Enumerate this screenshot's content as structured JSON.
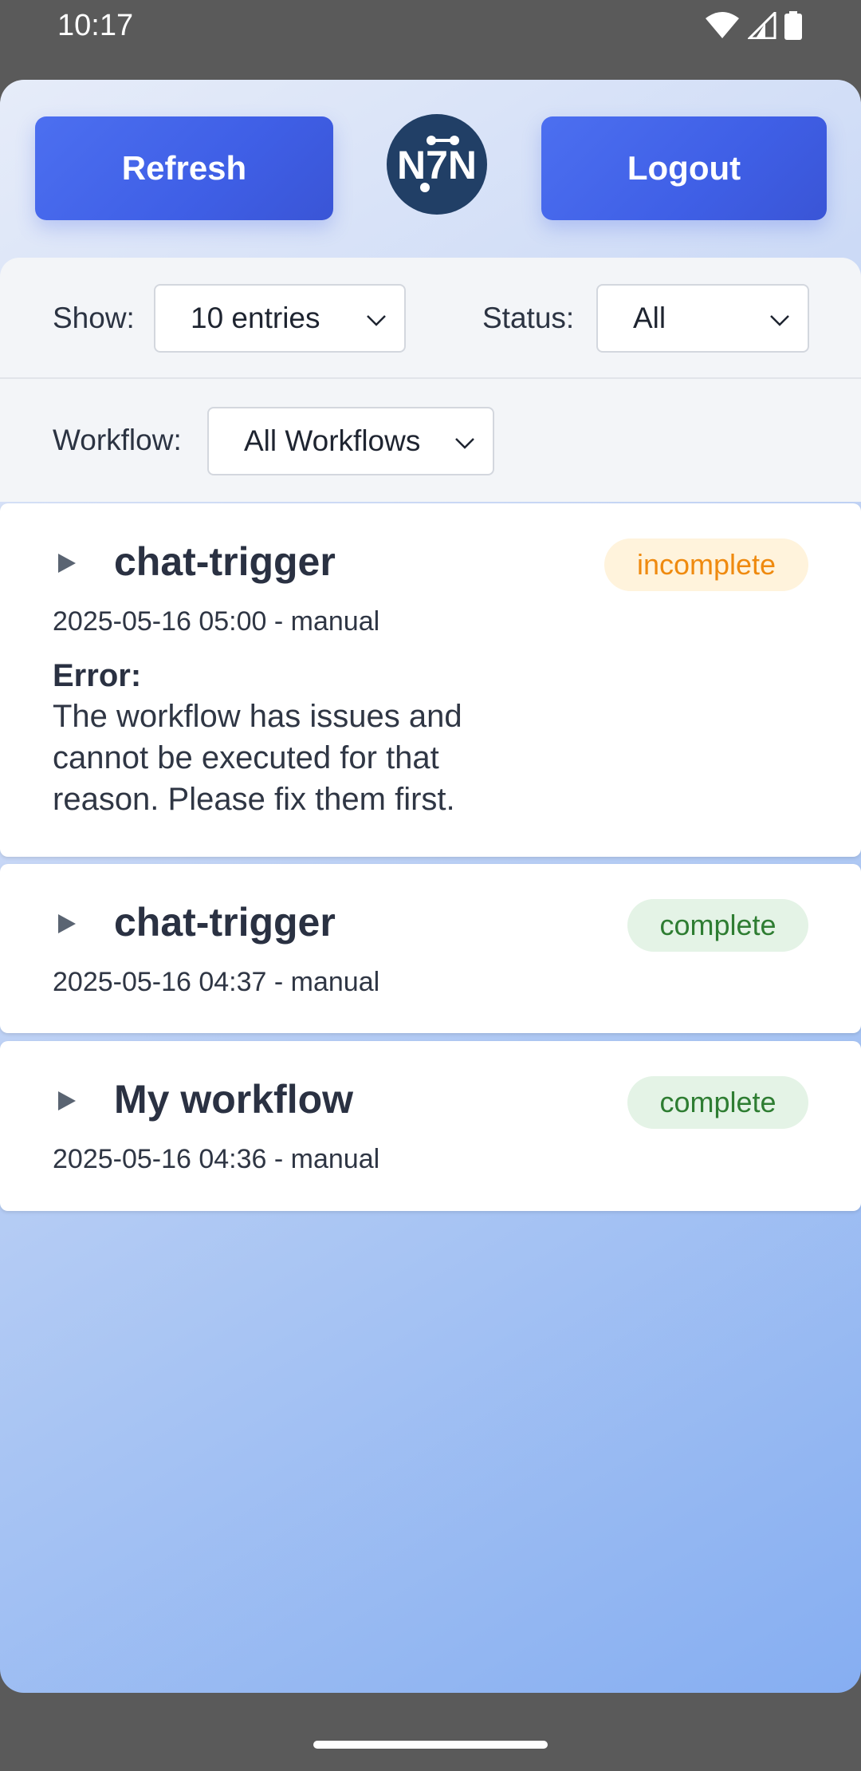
{
  "status_bar": {
    "time": "10:17",
    "icons": [
      "wifi-icon",
      "signal-icon",
      "battery-icon"
    ]
  },
  "header": {
    "refresh_label": "Refresh",
    "logout_label": "Logout",
    "logo_text": "N7N",
    "logo_icon": "n8n-logo"
  },
  "filters": {
    "show_label": "Show:",
    "show_value": "10 entries",
    "status_label": "Status:",
    "status_value": "All",
    "workflow_label": "Workflow:",
    "workflow_value": "All Workflows"
  },
  "executions": [
    {
      "name": "chat-trigger",
      "meta": "2025-05-16 05:00 - manual",
      "status": "incomplete",
      "error_label": "Error:",
      "error_text": "The workflow has issues and cannot be executed for that reason. Please fix them first."
    },
    {
      "name": "chat-trigger",
      "meta": "2025-05-16 04:37 - manual",
      "status": "complete"
    },
    {
      "name": "My workflow",
      "meta": "2025-05-16 04:36 - manual",
      "status": "complete"
    }
  ],
  "colors": {
    "primary": "#4466ee",
    "logo_bg": "#213f66",
    "incomplete_text": "#ef8a0f",
    "incomplete_bg": "#fff3dc",
    "complete_text": "#2e7d32",
    "complete_bg": "#e4f3e6"
  }
}
